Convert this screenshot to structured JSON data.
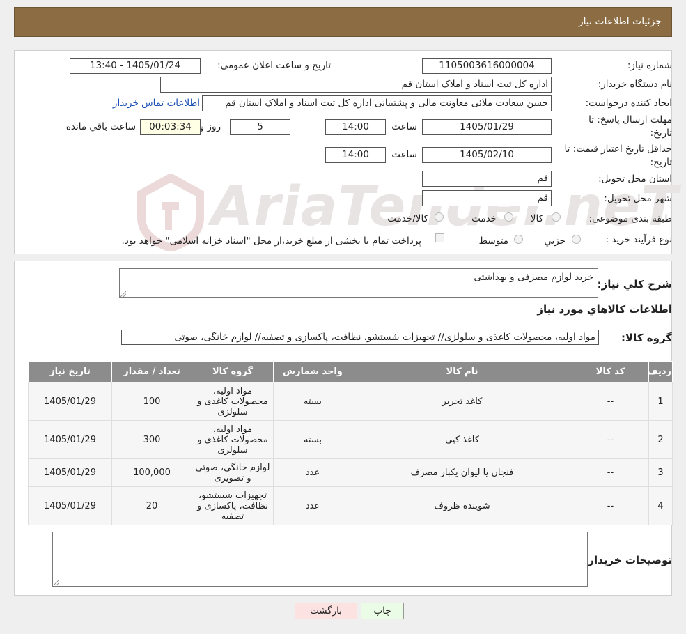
{
  "header": {
    "title": "جزئیات اطلاعات نیاز"
  },
  "form": {
    "need_number": {
      "label": "شماره نیاز:",
      "value": "1105003616000004"
    },
    "announce": {
      "label": "تاریخ و ساعت اعلان عمومی:",
      "value": "1405/01/24 - 13:40"
    },
    "buyer_org": {
      "label": "نام دستگاه خریدار:",
      "value": "اداره کل ثبت اسناد و املاک استان قم"
    },
    "requester": {
      "label": "ایجاد کننده درخواست:",
      "value": "حسن سعادت ملائی معاونت مالی و پشتیبانی اداره کل ثبت اسناد و املاک استان قم",
      "link": "اطلاعات تماس خریدار"
    },
    "deadline": {
      "label_line1": "مهلت ارسال پاسخ: تا",
      "label_line2": "تاریخ:",
      "date": "1405/01/29",
      "time_label": "ساعت",
      "time": "14:00",
      "days": "5",
      "days_label": "روز و",
      "remaining": "00:03:34",
      "remaining_label": "ساعت باقي مانده"
    },
    "validity": {
      "label_line1": "حداقل تاریخ اعتبار قیمت: تا",
      "label_line2": "تاریخ:",
      "date": "1405/02/10",
      "time_label": "ساعت",
      "time": "14:00"
    },
    "province": {
      "label": "استان محل تحویل:",
      "value": "قم"
    },
    "city": {
      "label": "شهر محل تحویل:",
      "value": "قم"
    },
    "category": {
      "label": "طبقه بندی موضوعی:",
      "options": [
        "کالا",
        "خدمت",
        "کالا/خدمت"
      ]
    },
    "process": {
      "label": "نوع فرآیند خرید :",
      "options": [
        "جزیي",
        "متوسط"
      ],
      "note": "پرداخت تمام یا بخشی از مبلغ خرید،از محل \"اسناد خزانه اسلامی\" خواهد بود."
    }
  },
  "watermark": {
    "text": "AriaTender.neT"
  },
  "summary": {
    "label": "شرح كلي نياز:",
    "value": "خرید لوازم مصرفی و بهداشتی",
    "items_title": "اطلاعات كالاهاي مورد نياز",
    "group_label": "گروه كالا:",
    "group_value": "مواد اولیه، محصولات کاغذی و سلولزی// تجهیزات شستشو، نظافت، پاکسازی و تصفیه// لوازم خانگی، صوتی"
  },
  "table": {
    "headers": [
      "رديف",
      "کد کالا",
      "نام کالا",
      "واحد شمارش",
      "گروه کالا",
      "تعداد / مقدار",
      "تاریخ نیاز"
    ],
    "rows": [
      [
        "1",
        "--",
        "کاغذ تحریر",
        "بسته",
        "مواد اولیه، محصولات کاغذی و سلولزی",
        "100",
        "1405/01/29"
      ],
      [
        "2",
        "--",
        "کاغذ کپی",
        "بسته",
        "مواد اولیه، محصولات کاغذی و سلولزی",
        "300",
        "1405/01/29"
      ],
      [
        "3",
        "--",
        "فنجان یا لیوان یکبار مصرف",
        "عدد",
        "لوازم خانگی، صوتی و تصویری",
        "100,000",
        "1405/01/29"
      ],
      [
        "4",
        "--",
        "شوینده ظروف",
        "عدد",
        "تجهیزات شستشو، نظافت، پاکسازی و تصفیه",
        "20",
        "1405/01/29"
      ]
    ]
  },
  "notes": {
    "label": "توضیحات خریدار:",
    "value": ""
  },
  "buttons": {
    "print": "چاپ",
    "back": "بازگشت"
  },
  "colors": {
    "header": "#8b6c43",
    "table_header": "#8c8c8c",
    "link": "#1a4fb4",
    "back_button": "#fde2e2",
    "print_button": "#eafbe6"
  }
}
